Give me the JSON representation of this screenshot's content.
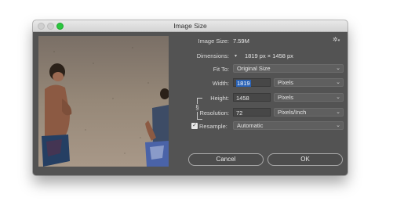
{
  "window": {
    "title": "Image Size"
  },
  "info": {
    "image_size_label": "Image Size:",
    "image_size_value": "7.59M",
    "dimensions_label": "Dimensions:",
    "dimensions_value": "1819 px  ×  1458 px"
  },
  "form": {
    "fit_to_label": "Fit To:",
    "fit_to_value": "Original Size",
    "width_label": "Width:",
    "width_value": "1819",
    "width_unit": "Pixels",
    "height_label": "Height:",
    "height_value": "1458",
    "height_unit": "Pixels",
    "resolution_label": "Resolution:",
    "resolution_value": "72",
    "resolution_unit": "Pixels/Inch",
    "resample_label": "Resample:",
    "resample_checked": true,
    "resample_value": "Automatic"
  },
  "buttons": {
    "cancel": "Cancel",
    "ok": "OK"
  },
  "icons": {
    "gear": "gear-icon",
    "link": "link-icon",
    "check": "checkmark-icon",
    "chevron": "chevron-updown-icon"
  },
  "colors": {
    "dialog_bg": "#535353",
    "field_bg": "#474747",
    "selection": "#2a62b5",
    "zoom_button": "#2bc73f"
  }
}
